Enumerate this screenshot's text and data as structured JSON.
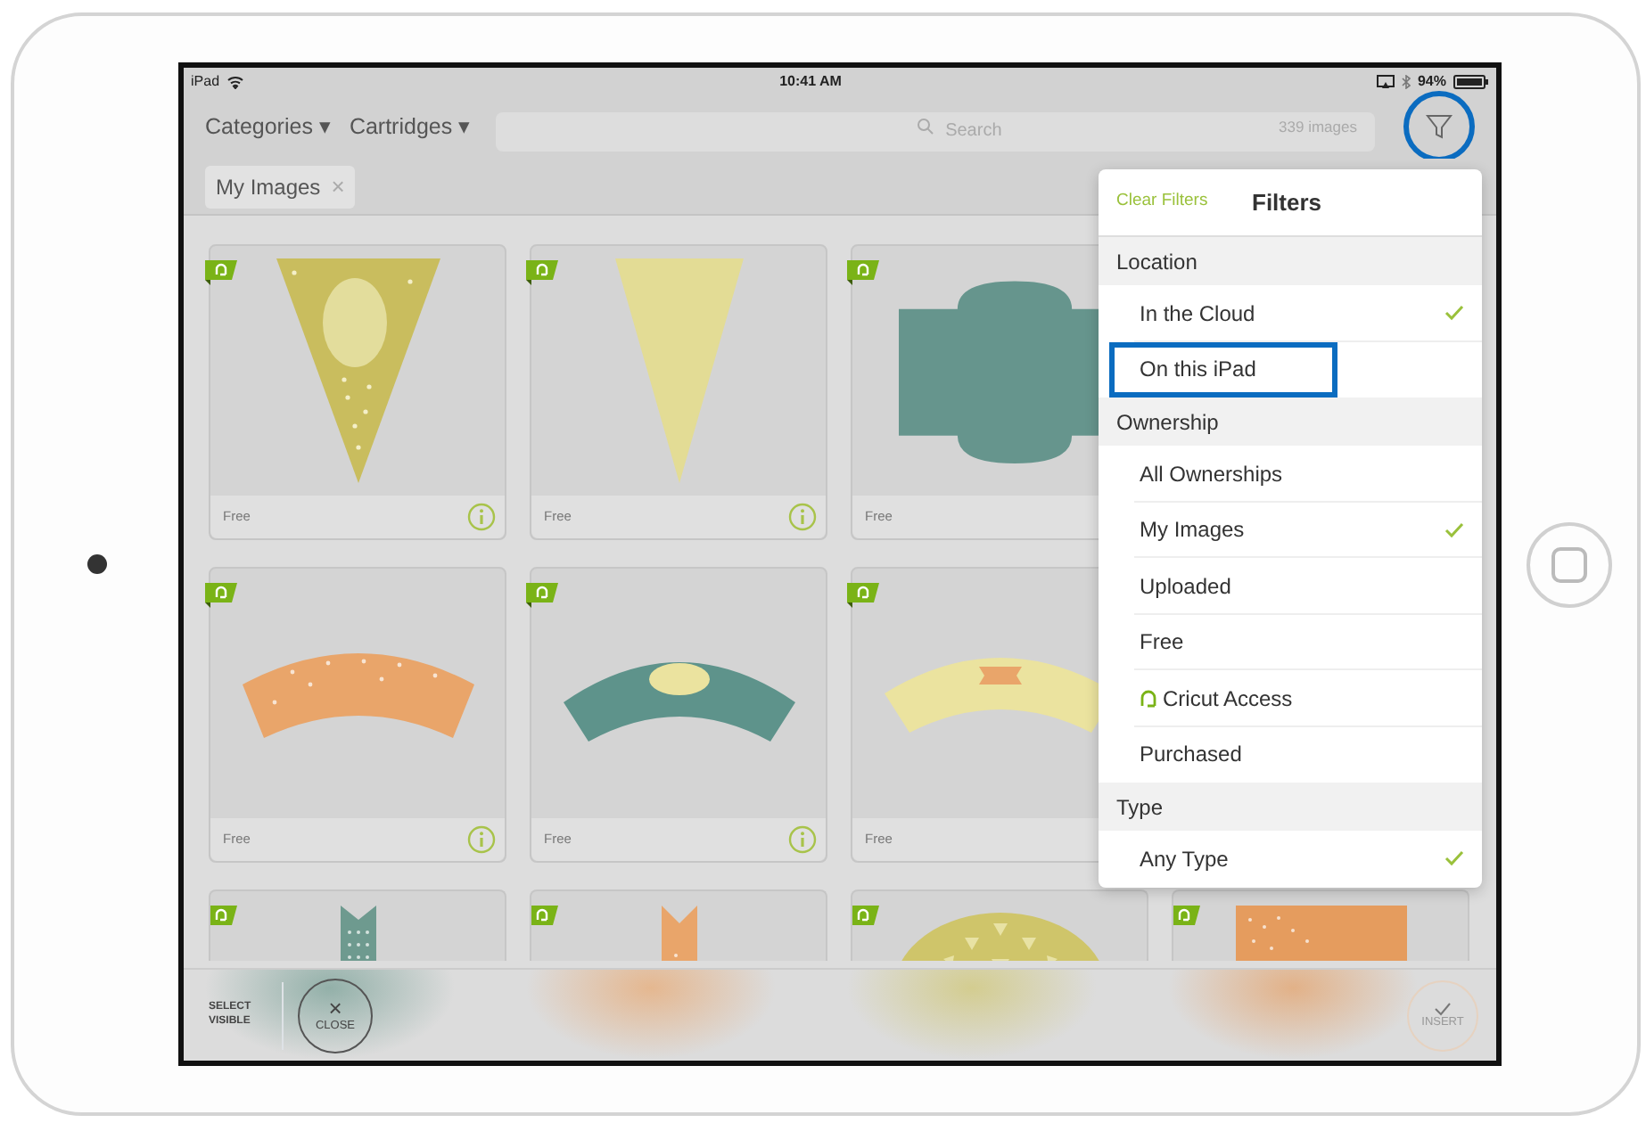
{
  "status_bar": {
    "device": "iPad",
    "time": "10:41 AM",
    "battery": "94%"
  },
  "toolbar": {
    "menus": [
      "Categories ▾",
      "Cartridges ▾"
    ],
    "search": {
      "placeholder": "Search"
    },
    "count": "339 images",
    "filter_button": {
      "highlighted": true
    }
  },
  "chips": [
    {
      "label": "My Images",
      "close": "×"
    }
  ],
  "grid": {
    "rows": [
      {
        "cards": [
          {
            "kind": "dotted-pennant",
            "color": "#c9bd5e",
            "label": "Free",
            "info": true
          },
          {
            "kind": "pennant",
            "color": "#e3dc95",
            "label": "Free",
            "info": true
          },
          {
            "kind": "plaque",
            "color": "#66958d",
            "label": "Free",
            "info": false
          }
        ]
      },
      {
        "cards": [
          {
            "kind": "dotted-arc",
            "color": "#e9a56a",
            "label": "Free",
            "info": true
          },
          {
            "kind": "oval-arc",
            "color": "#5e938b",
            "label": "Free",
            "info": true
          },
          {
            "kind": "ribbon-arc",
            "color": "#ebe39f",
            "label": "Free",
            "info": false
          }
        ]
      },
      {
        "cards": [
          {
            "kind": "dotted-banner",
            "color": "#6e9a8f",
            "info": false
          },
          {
            "kind": "banner",
            "color": "#e9a56a",
            "info": false
          },
          {
            "kind": "medallion",
            "color": "#cfc56a",
            "info": false
          },
          {
            "kind": "dotted-block",
            "color": "#e59c5e",
            "info": false
          }
        ]
      }
    ]
  },
  "filters": {
    "clear": "Clear Filters",
    "title": "Filters",
    "sections": [
      {
        "title": "Location",
        "items": [
          {
            "label": "In the Cloud",
            "kind": "plain",
            "checked": true,
            "highlighted": false
          },
          {
            "label": "On this iPad",
            "kind": "plain",
            "checked": false,
            "highlighted": true
          }
        ]
      },
      {
        "title": "Ownership",
        "items": [
          {
            "label": "All Ownerships",
            "kind": "plain",
            "checked": false,
            "highlighted": false
          },
          {
            "label": "My Images",
            "kind": "plain",
            "checked": true,
            "highlighted": false
          },
          {
            "label": "Uploaded",
            "kind": "plain",
            "checked": false,
            "highlighted": false
          },
          {
            "label": "Free",
            "kind": "plain",
            "checked": false,
            "highlighted": false
          },
          {
            "label": "Cricut Access",
            "kind": "access",
            "checked": false,
            "highlighted": false
          },
          {
            "label": "Purchased",
            "kind": "plain",
            "checked": false,
            "highlighted": false
          }
        ]
      },
      {
        "title": "Type",
        "items": [
          {
            "label": "Any Type",
            "kind": "plain",
            "checked": true,
            "highlighted": false
          }
        ]
      }
    ]
  },
  "bottom_bar": {
    "select_visible": "SELECT VISIBLE",
    "close": "CLOSE",
    "close_icon": "×",
    "insert": "INSERT",
    "insert_disabled": true
  }
}
